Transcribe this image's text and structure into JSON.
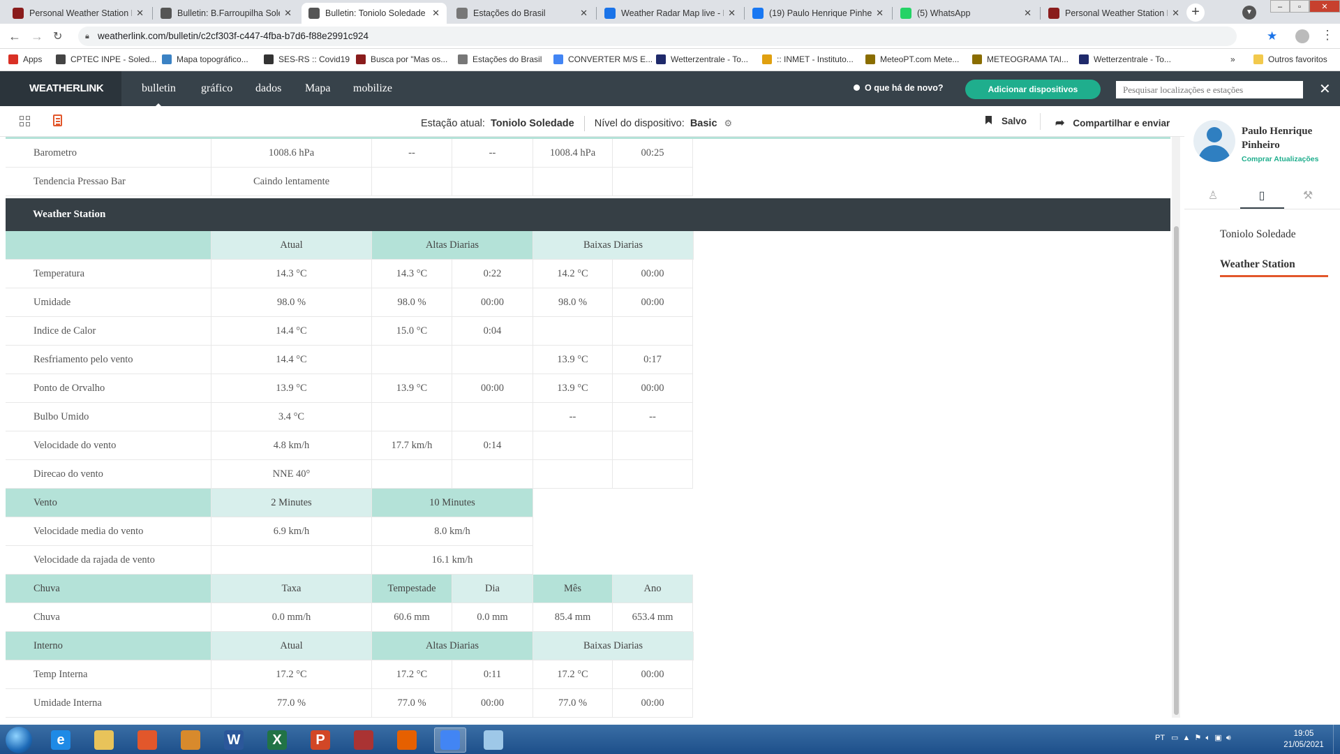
{
  "browser": {
    "tabs": [
      {
        "title": "Personal Weather Station D",
        "icon_color": "#8a1c1c",
        "active": false
      },
      {
        "title": "Bulletin: B.Farroupilha Sole",
        "icon_color": "#555555",
        "active": false
      },
      {
        "title": "Bulletin: Toniolo Soledade",
        "icon_color": "#555555",
        "active": true
      },
      {
        "title": "Estações do Brasil",
        "icon_color": "#777777",
        "active": false
      },
      {
        "title": "Weather Radar Map live - R",
        "icon_color": "#1a73e8",
        "active": false
      },
      {
        "title": "(19) Paulo Henrique Pinheir",
        "icon_color": "#1877f2",
        "active": false
      },
      {
        "title": "(5) WhatsApp",
        "icon_color": "#25d366",
        "active": false
      },
      {
        "title": "Personal Weather Station D",
        "icon_color": "#8a1c1c",
        "active": false
      }
    ],
    "url": "weatherlink.com/bulletin/c2cf303f-c447-4fba-b7d6-f88e2991c924",
    "bookmarks": [
      {
        "label": "Apps",
        "color": "#d93025"
      },
      {
        "label": "CPTEC INPE - Soled...",
        "color": "#444444"
      },
      {
        "label": "Mapa topográfico...",
        "color": "#3b82c4"
      },
      {
        "label": "SES-RS :: Covid19",
        "color": "#333333"
      },
      {
        "label": "Busca por \"Mas os...",
        "color": "#8a1c1c"
      },
      {
        "label": "Estações do Brasil",
        "color": "#777777"
      },
      {
        "label": "CONVERTER M/S E...",
        "color": "#4285f4"
      },
      {
        "label": "Wetterzentrale - To...",
        "color": "#1f2a6b"
      },
      {
        "label": ":: INMET - Instituto...",
        "color": "#e0a010"
      },
      {
        "label": "MeteoPT.com Mete...",
        "color": "#8a6d00"
      },
      {
        "label": "METEOGRAMA TAI...",
        "color": "#8a6d00"
      },
      {
        "label": "Wetterzentrale - To...",
        "color": "#1f2a6b"
      },
      {
        "label": "»",
        "color": ""
      },
      {
        "label": "Outros favoritos",
        "color": "#f2c94c"
      }
    ]
  },
  "nav": {
    "logo": "WEATHERLINK",
    "links": [
      "bulletin",
      "gráfico",
      "dados",
      "Mapa",
      "mobilize"
    ],
    "whats_new": "O que há de novo?",
    "add_devices": "Adicionar dispositivos",
    "search_placeholder": "Pesquisar localizações e estações"
  },
  "station_bar": {
    "current_label": "Estação atual:",
    "current_value": "Toniolo Soledade",
    "level_label": "Nível do dispositivo:",
    "level_value": "Basic",
    "saved": "Salvo",
    "share": "Compartilhar e enviar"
  },
  "table": {
    "top_rows": [
      [
        "Barometro",
        "1008.6 hPa",
        "--",
        "--",
        "1008.4 hPa",
        "00:25"
      ],
      [
        "Tendencia Pressao Bar",
        "Caindo lentamente",
        "",
        "",
        "",
        ""
      ]
    ],
    "section_title": "Weather Station",
    "ws_header": [
      "",
      "Atual",
      "Altas Diarias",
      "Baixas Diarias"
    ],
    "ws_rows": [
      [
        "Temperatura",
        "14.3 °C",
        "14.3 °C",
        "0:22",
        "14.2 °C",
        "00:00"
      ],
      [
        "Umidade",
        "98.0 %",
        "98.0 %",
        "00:00",
        "98.0 %",
        "00:00"
      ],
      [
        "Indice de Calor",
        "14.4 °C",
        "15.0 °C",
        "0:04",
        "",
        ""
      ],
      [
        "Resfriamento pelo vento",
        "14.4 °C",
        "",
        "",
        "13.9 °C",
        "0:17"
      ],
      [
        "Ponto de Orvalho",
        "13.9 °C",
        "13.9 °C",
        "00:00",
        "13.9 °C",
        "00:00"
      ],
      [
        "Bulbo Umido",
        "3.4 °C",
        "",
        "",
        "--",
        "--"
      ],
      [
        "Velocidade do vento",
        "4.8 km/h",
        "17.7 km/h",
        "0:14",
        "",
        ""
      ],
      [
        "Direcao do vento",
        "NNE 40°",
        "",
        "",
        "",
        ""
      ]
    ],
    "wind_header": [
      "Vento",
      "2 Minutes",
      "10 Minutes"
    ],
    "wind_rows": [
      [
        "Velocidade media do vento",
        "6.9 km/h",
        "8.0 km/h"
      ],
      [
        "Velocidade da rajada de vento",
        "",
        "16.1 km/h"
      ]
    ],
    "rain_header": [
      "Chuva",
      "Taxa",
      "Tempestade",
      "Dia",
      "Mês",
      "Ano"
    ],
    "rain_row": [
      "Chuva",
      "0.0 mm/h",
      "60.6 mm",
      "0.0 mm",
      "85.4 mm",
      "653.4 mm"
    ],
    "indoor_header": [
      "Interno",
      "Atual",
      "Altas Diarias",
      "Baixas Diarias"
    ],
    "indoor_rows": [
      [
        "Temp Interna",
        "17.2 °C",
        "17.2 °C",
        "0:11",
        "17.2 °C",
        "00:00"
      ],
      [
        "Umidade Interna",
        "77.0 %",
        "77.0 %",
        "00:00",
        "77.0 %",
        "00:00"
      ]
    ]
  },
  "sidebar": {
    "user_name": "Paulo Henrique Pinheiro",
    "upgrade": "Comprar Atualizações",
    "station": "Toniolo Soledade",
    "device": "Weather Station"
  },
  "taskbar": {
    "lang": "PT",
    "time": "19:05",
    "date": "21/05/2021",
    "apps": [
      {
        "label": "e",
        "color": "#1e8ae6"
      },
      {
        "label": "",
        "color": "#e8c35a"
      },
      {
        "label": "",
        "color": "#e2572b"
      },
      {
        "label": "",
        "color": "#d88a2c"
      },
      {
        "label": "W",
        "color": "#2b579a"
      },
      {
        "label": "X",
        "color": "#217346"
      },
      {
        "label": "P",
        "color": "#d24726"
      },
      {
        "label": "",
        "color": "#a33"
      },
      {
        "label": "",
        "color": "#e66000"
      },
      {
        "label": "",
        "color": "#4285f4"
      },
      {
        "label": "",
        "color": "#9ec8e8"
      }
    ]
  }
}
